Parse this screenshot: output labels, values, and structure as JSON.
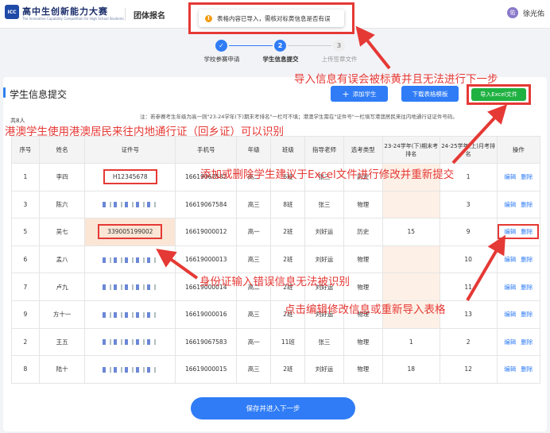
{
  "header": {
    "logo_text": "ICC",
    "logo_title": "高中生创新能力大赛",
    "logo_subtitle": "The Innovative Capability Competition for High School Students",
    "nav_title": "团体报名",
    "user_avatar": "佑",
    "user_name": "徐光佑"
  },
  "toast": {
    "message": "表格内容已导入，需核对标黄信息是否有误",
    "icon": "warning-icon"
  },
  "steps": [
    {
      "number": "✓",
      "label": "学校参赛申请",
      "state": "done"
    },
    {
      "number": "2",
      "label": "学生信息提交",
      "state": "active"
    },
    {
      "number": "3",
      "label": "上传签章文件",
      "state": "todo"
    }
  ],
  "section": {
    "title": "学生信息提交",
    "add_button": "添加学生",
    "download_button": "下载表格模板",
    "import_button": "导入Excel文件",
    "count": "共8人",
    "note": "注：若参赛考生年级为高一则\"23-24学年(下)期末考排名\"一栏可不填；港澳学生需在\"证件号\"一栏填写港澳居民来往内地通行证证件号码。"
  },
  "table": {
    "headers": [
      "序号",
      "姓名",
      "证件号",
      "手机号",
      "年级",
      "班级",
      "指导老师",
      "选考类型",
      "23-24学年(下)期末考排名",
      "24-25学年(上)月考排名",
      "操作"
    ],
    "rows": [
      {
        "no": "1",
        "name": "李四",
        "id": "H12345678",
        "phone": "16619067582",
        "grade": "高二",
        "class": "6班",
        "teacher": "张三",
        "type": "历史",
        "rank1": "",
        "rank2": "1",
        "edit": "编辑",
        "delete": "删除"
      },
      {
        "no": "3",
        "name": "陈六",
        "id": "",
        "phone": "16619067584",
        "grade": "高三",
        "class": "8班",
        "teacher": "张三",
        "type": "物理",
        "rank1": "",
        "rank2": "3",
        "edit": "编辑",
        "delete": "删除"
      },
      {
        "no": "5",
        "name": "吴七",
        "id": "339005199002",
        "phone": "16619000012",
        "grade": "高一",
        "class": "2班",
        "teacher": "刘好运",
        "type": "历史",
        "rank1": "15",
        "rank2": "9",
        "edit": "编辑",
        "delete": "删除"
      },
      {
        "no": "6",
        "name": "孟八",
        "id": "",
        "phone": "16619000013",
        "grade": "高三",
        "class": "2班",
        "teacher": "刘好运",
        "type": "物理",
        "rank1": "",
        "rank2": "10",
        "edit": "编辑",
        "delete": "删除"
      },
      {
        "no": "7",
        "name": "卢九",
        "id": "",
        "phone": "16619000014",
        "grade": "高二",
        "class": "2班",
        "teacher": "刘好运",
        "type": "物理",
        "rank1": "",
        "rank2": "11",
        "edit": "编辑",
        "delete": "删除"
      },
      {
        "no": "9",
        "name": "方十一",
        "id": "",
        "phone": "16619000016",
        "grade": "高三",
        "class": "2班",
        "teacher": "刘好运",
        "type": "物理",
        "rank1": "",
        "rank2": "13",
        "edit": "编辑",
        "delete": "删除"
      },
      {
        "no": "2",
        "name": "王五",
        "id": "",
        "phone": "16619067583",
        "grade": "高一",
        "class": "11班",
        "teacher": "张三",
        "type": "物理",
        "rank1": "1",
        "rank2": "2",
        "edit": "编辑",
        "delete": "删除"
      },
      {
        "no": "8",
        "name": "陆十",
        "id": "",
        "phone": "16619000015",
        "grade": "高三",
        "class": "2班",
        "teacher": "刘好运",
        "type": "物理",
        "rank1": "18",
        "rank2": "12",
        "edit": "编辑",
        "delete": "删除"
      }
    ]
  },
  "save_button": "保存并进入下一步",
  "annotations": {
    "import_error": "导入信息有误会被标黄并且无法进行下一步",
    "hk_macau": "港澳学生使用港澳居民来往内地通行证（回乡证）可以识别",
    "add_delete": "添加或删除学生建议于Excel文件进行修改并重新提交",
    "id_error": "身份证输入错误信息无法被识别",
    "edit_hint": "点击编辑修改信息或重新导入表格"
  },
  "colors": {
    "primary": "#2f7cf6",
    "import_green": "#1fb141",
    "highlight": "#fbe6d6",
    "annotation_red": "#e53935"
  }
}
